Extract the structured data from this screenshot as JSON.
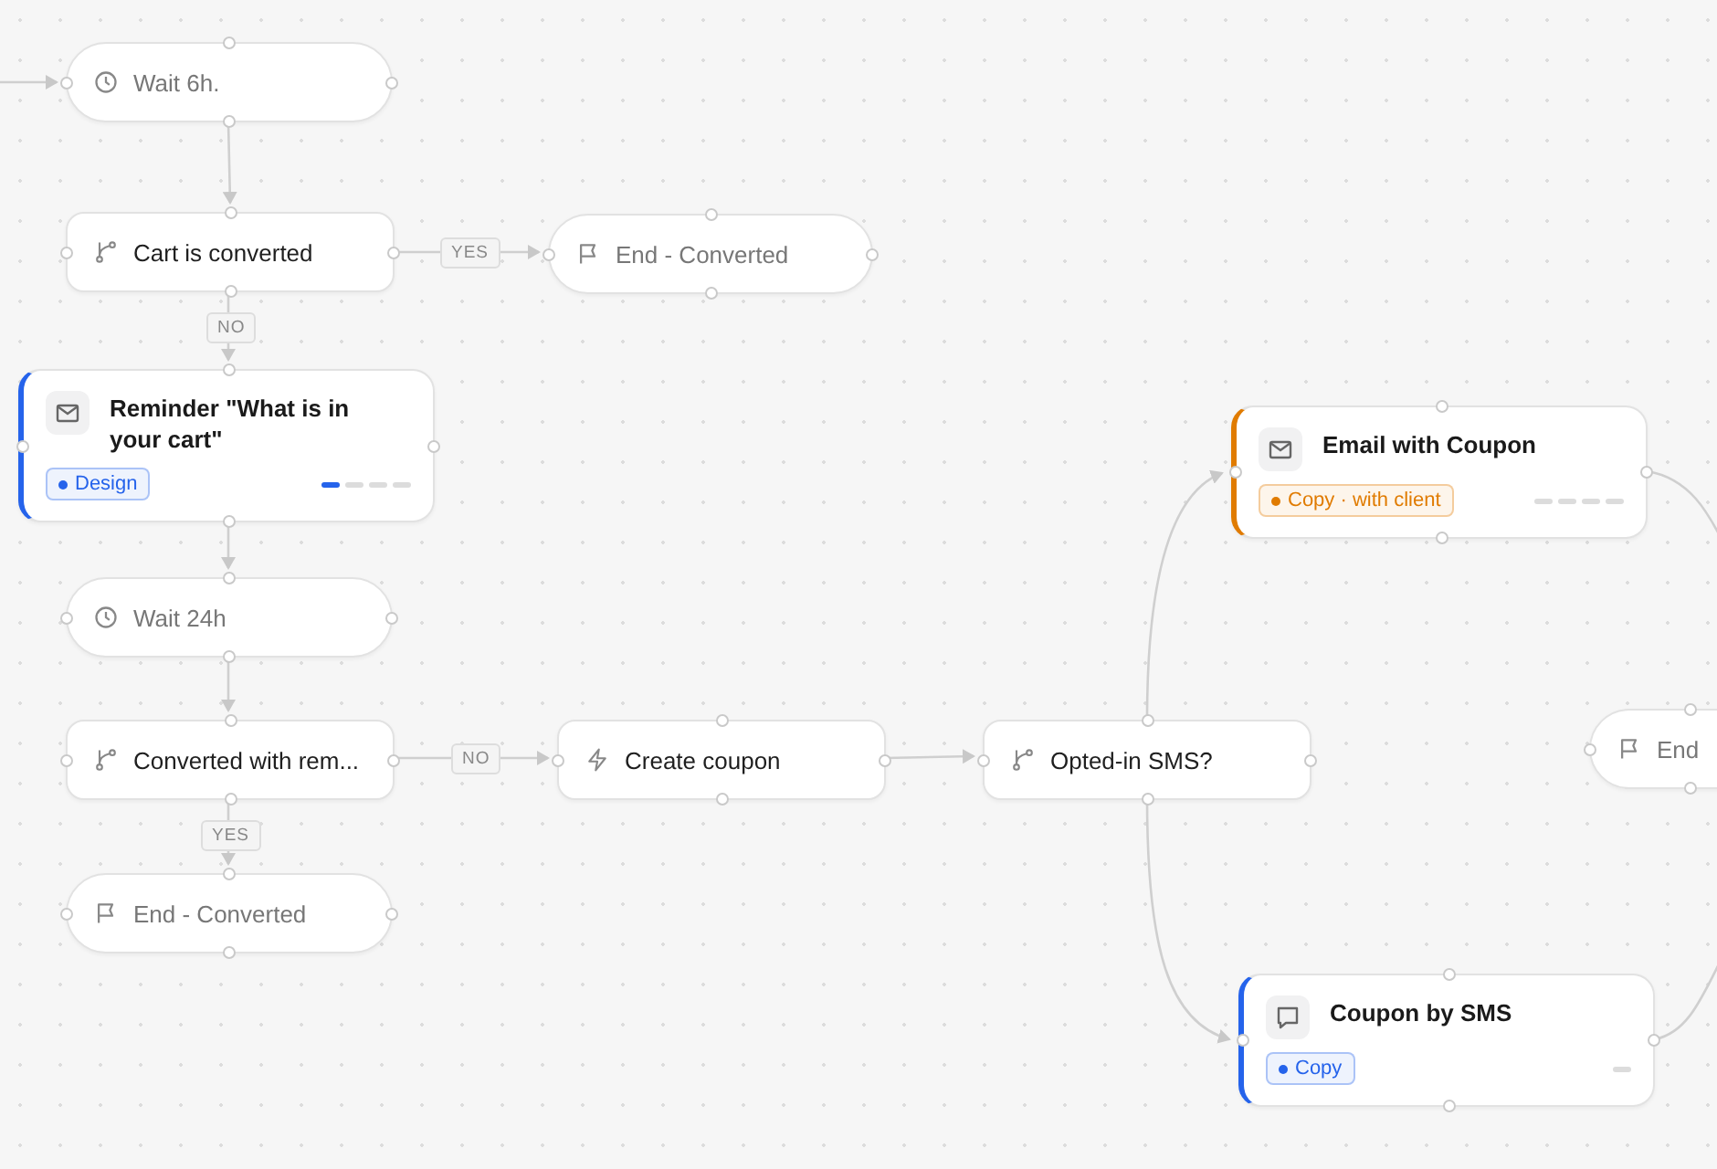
{
  "nodes": [
    {
      "kind": "wait",
      "label": "Wait 6h."
    },
    {
      "kind": "condition",
      "label": "Cart is converted"
    },
    {
      "kind": "end",
      "label": "End - Converted"
    },
    {
      "kind": "email",
      "label": "Reminder \"What is in your cart\"",
      "color": "#2563eb",
      "tag": "Design",
      "steps": [
        {
          "done": true
        },
        {
          "done": false
        },
        {
          "done": false
        },
        {
          "done": false
        }
      ]
    },
    {
      "kind": "wait",
      "label": "Wait 24h"
    },
    {
      "kind": "condition",
      "label": "Converted with rem..."
    },
    {
      "kind": "end",
      "label": "End - Converted"
    },
    {
      "kind": "action",
      "label": "Create coupon"
    },
    {
      "kind": "condition",
      "label": "Opted-in SMS?"
    },
    {
      "kind": "email",
      "label": "Email with Coupon",
      "color": "#e07b00",
      "tag": "Copy · with client",
      "steps": [
        {
          "done": false
        },
        {
          "done": false
        },
        {
          "done": false
        },
        {
          "done": false
        }
      ]
    },
    {
      "kind": "end",
      "label": "End"
    },
    {
      "kind": "sms",
      "label": "Coupon by SMS",
      "color": "#2563eb",
      "tag": "Copy",
      "steps": [
        {
          "done": false
        }
      ]
    }
  ],
  "edge_labels": [
    {
      "text": "YES"
    },
    {
      "text": "NO"
    },
    {
      "text": "NO"
    },
    {
      "text": "YES"
    }
  ]
}
